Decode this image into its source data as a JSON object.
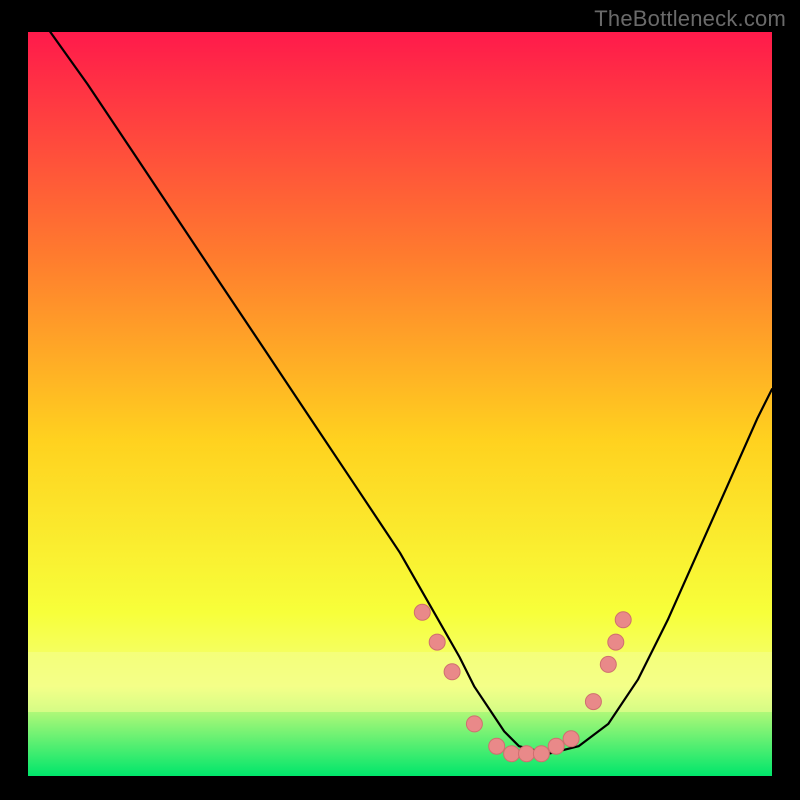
{
  "watermark": "TheBottleneck.com",
  "colors": {
    "bg": "#000000",
    "gradient_top": "#ff1a4b",
    "gradient_mid1": "#ff7b2e",
    "gradient_mid2": "#ffd21f",
    "gradient_mid3": "#f7ff3a",
    "gradient_band": "#f3ff7d",
    "gradient_bottom": "#00e66b",
    "curve": "#000000",
    "marker_fill": "#e98989",
    "marker_stroke": "#cf6f6f"
  },
  "chart_data": {
    "type": "line",
    "title": "",
    "xlabel": "",
    "ylabel": "",
    "xlim": [
      0,
      100
    ],
    "ylim": [
      0,
      100
    ],
    "grid": false,
    "legend": false,
    "series": [
      {
        "name": "curve",
        "x": [
          3,
          8,
          14,
          20,
          26,
          32,
          38,
          44,
          50,
          54,
          58,
          60,
          62,
          64,
          66,
          70,
          74,
          78,
          82,
          86,
          90,
          94,
          98,
          100
        ],
        "y": [
          100,
          93,
          84,
          75,
          66,
          57,
          48,
          39,
          30,
          23,
          16,
          12,
          9,
          6,
          4,
          3,
          4,
          7,
          13,
          21,
          30,
          39,
          48,
          52
        ]
      }
    ],
    "markers": {
      "name": "highlight-points",
      "x": [
        53,
        55,
        57,
        60,
        63,
        65,
        67,
        69,
        71,
        73,
        76,
        78,
        79,
        80
      ],
      "y": [
        22,
        18,
        14,
        7,
        4,
        3,
        3,
        3,
        4,
        5,
        10,
        15,
        18,
        21
      ]
    }
  }
}
